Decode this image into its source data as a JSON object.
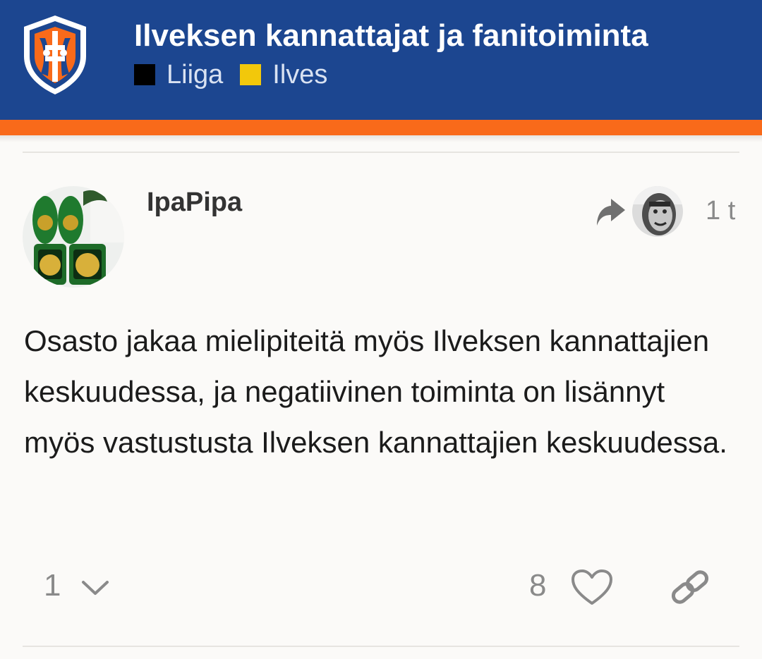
{
  "header": {
    "title": "Ilveksen kannattajat ja fanitoiminta",
    "categories": [
      {
        "label": "Liiga",
        "color": "#000000"
      },
      {
        "label": "Ilves",
        "color": "#f2c80b"
      }
    ],
    "colors": {
      "bar": "#1c4690",
      "stripe": "#f96a1a"
    },
    "logo_icon": "ilves-shield-logo"
  },
  "post": {
    "username": "IpaPipa",
    "reply_icon": "reply-arrow-icon",
    "date": "1 t",
    "body": "Osasto jakaa mielipiteitä myös Ilveksen kannattajien keskuudessa, ja negatiivinen toiminta on lisännyt myös vastustusta Ilveksen kannattajien keskuudessa."
  },
  "actions": {
    "replies_count": "1",
    "likes_count": "8",
    "icons": [
      "chevron-down-icon",
      "heart-icon",
      "link-icon"
    ]
  }
}
